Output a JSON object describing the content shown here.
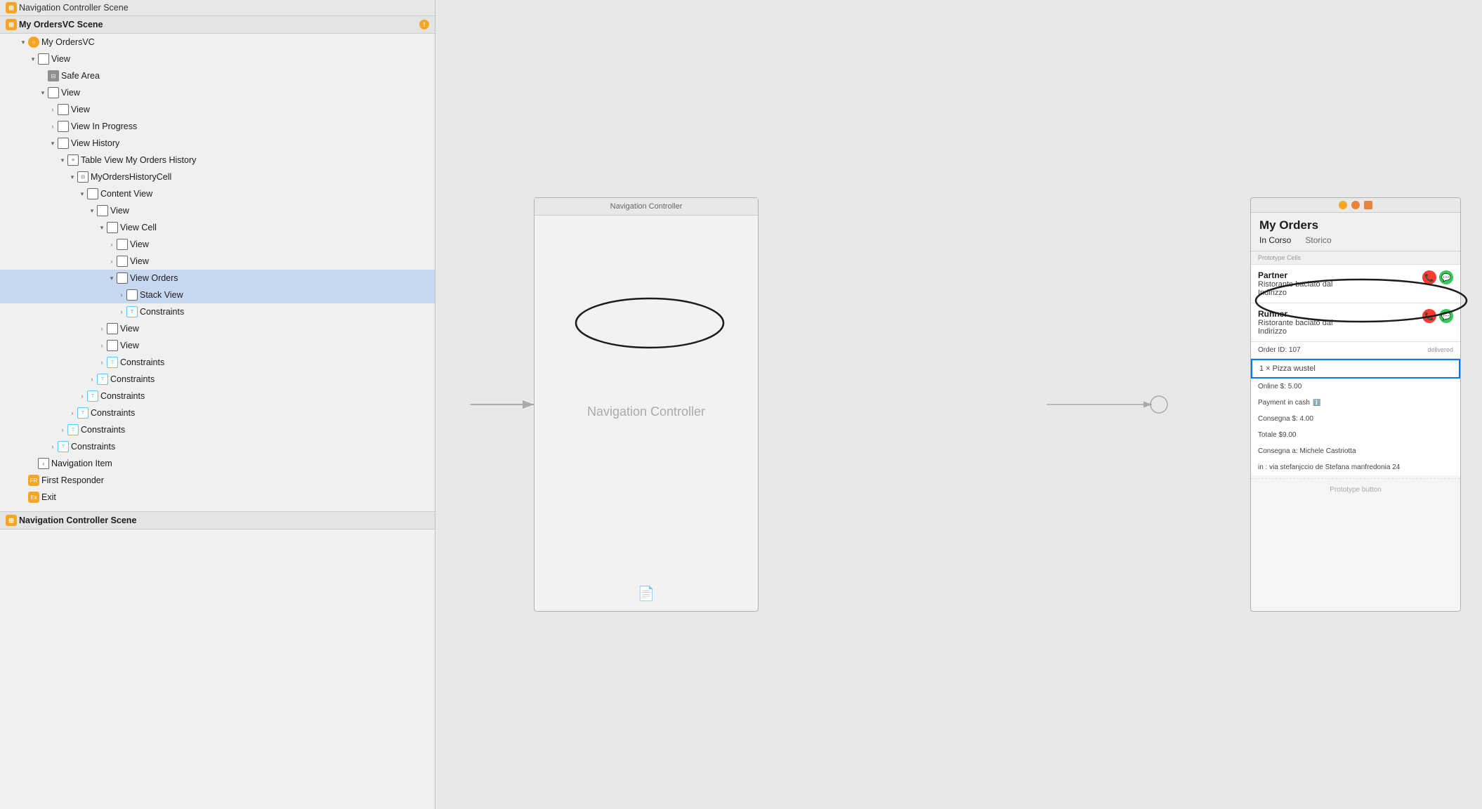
{
  "navigator": {
    "topScene": {
      "label": "Navigation Controller Scene",
      "collapsed": true
    },
    "mainScene": {
      "label": "My OrdersVC Scene",
      "warning": true,
      "items": [
        {
          "id": "myOrdersVC",
          "label": "My OrdersVC",
          "indent": 1,
          "open": true,
          "icon": "vc"
        },
        {
          "id": "view1",
          "label": "View",
          "indent": 2,
          "open": true,
          "icon": "view"
        },
        {
          "id": "safeArea",
          "label": "Safe Area",
          "indent": 3,
          "open": false,
          "icon": "safe"
        },
        {
          "id": "view2",
          "label": "View",
          "indent": 3,
          "open": true,
          "icon": "view"
        },
        {
          "id": "view3",
          "label": "View",
          "indent": 4,
          "open": false,
          "icon": "view"
        },
        {
          "id": "viewInProgress",
          "label": "View In Progress",
          "indent": 4,
          "open": false,
          "icon": "view"
        },
        {
          "id": "viewHistory",
          "label": "View History",
          "indent": 4,
          "open": true,
          "icon": "view"
        },
        {
          "id": "tableView",
          "label": "Table View My Orders History",
          "indent": 5,
          "open": true,
          "icon": "tableview"
        },
        {
          "id": "historyCell",
          "label": "MyOrdersHistoryCell",
          "indent": 6,
          "open": true,
          "icon": "cell"
        },
        {
          "id": "contentView",
          "label": "Content View",
          "indent": 7,
          "open": true,
          "icon": "view"
        },
        {
          "id": "view4",
          "label": "View",
          "indent": 8,
          "open": true,
          "icon": "view"
        },
        {
          "id": "viewCell",
          "label": "View Cell",
          "indent": 9,
          "open": true,
          "icon": "view"
        },
        {
          "id": "view5",
          "label": "View",
          "indent": 10,
          "open": false,
          "icon": "view"
        },
        {
          "id": "view6",
          "label": "View",
          "indent": 10,
          "open": false,
          "icon": "view"
        },
        {
          "id": "viewOrders",
          "label": "View Orders",
          "indent": 10,
          "open": true,
          "icon": "view",
          "selected": true
        },
        {
          "id": "stackView",
          "label": "Stack View",
          "indent": 11,
          "open": false,
          "icon": "stackview",
          "highlighted": true
        },
        {
          "id": "constraints1",
          "label": "Constraints",
          "indent": 11,
          "open": false,
          "icon": "constraints"
        },
        {
          "id": "view7",
          "label": "View",
          "indent": 9,
          "open": false,
          "icon": "view"
        },
        {
          "id": "view8",
          "label": "View",
          "indent": 9,
          "open": false,
          "icon": "view"
        },
        {
          "id": "constraints2",
          "label": "Constraints",
          "indent": 9,
          "open": false,
          "icon": "constraints"
        },
        {
          "id": "constraints3",
          "label": "Constraints",
          "indent": 8,
          "open": false,
          "icon": "constraints"
        },
        {
          "id": "constraints4",
          "label": "Constraints",
          "indent": 7,
          "open": false,
          "icon": "constraints"
        },
        {
          "id": "constraints5",
          "label": "Constraints",
          "indent": 6,
          "open": false,
          "icon": "constraints"
        },
        {
          "id": "constraints6",
          "label": "Constraints",
          "indent": 5,
          "open": false,
          "icon": "constraints"
        },
        {
          "id": "constraints7",
          "label": "Constraints",
          "indent": 4,
          "open": false,
          "icon": "constraints"
        }
      ],
      "bottom": [
        {
          "id": "navItem",
          "label": "Navigation Item",
          "indent": 2,
          "icon": "navitem"
        },
        {
          "id": "firstResponder",
          "label": "First Responder",
          "indent": 1,
          "icon": "firstresponder"
        },
        {
          "id": "exit",
          "label": "Exit",
          "indent": 1,
          "icon": "exit"
        }
      ]
    },
    "bottomScene": {
      "label": "Navigation Controller Scene",
      "collapsed": true
    }
  },
  "canvas": {
    "ncFrame": {
      "title": "Navigation Controller",
      "bodyText": "Navigation Controller",
      "docIcon": "📄"
    },
    "ordersFrame": {
      "topDots": [
        "yellow",
        "orange",
        "grid"
      ],
      "navTitle": "My Orders",
      "segments": [
        "In Corso",
        "Storico"
      ],
      "prototypeLabel": "Prototype Cells",
      "partnerCell": {
        "title": "Partner",
        "subtitle1": "Ristorante baciato dal",
        "subtitle2": "Indirizzo",
        "hasBtns": true
      },
      "runnerCell": {
        "title": "Runner",
        "subtitle1": "Ristorante baciato dal",
        "subtitle2": "Indirizzo",
        "hasBtns": true
      },
      "orderCell": {
        "orderLine": "Order ID: 107",
        "statusLine": "delivered",
        "pizzaLine": "1 × Pizza wustel",
        "onlineLine": "Online $: 5.00",
        "paymentLine": "Payment in cash",
        "consegnaLine": "Consegna $: 4.00",
        "totaleLine": "Totale $9.00",
        "consegnaALine": "Consegna a: Michele Castriotta",
        "inLine": "in : via stefanjccio de Stefana manfredonia 24"
      },
      "protoBtn": "Prototype button"
    }
  }
}
